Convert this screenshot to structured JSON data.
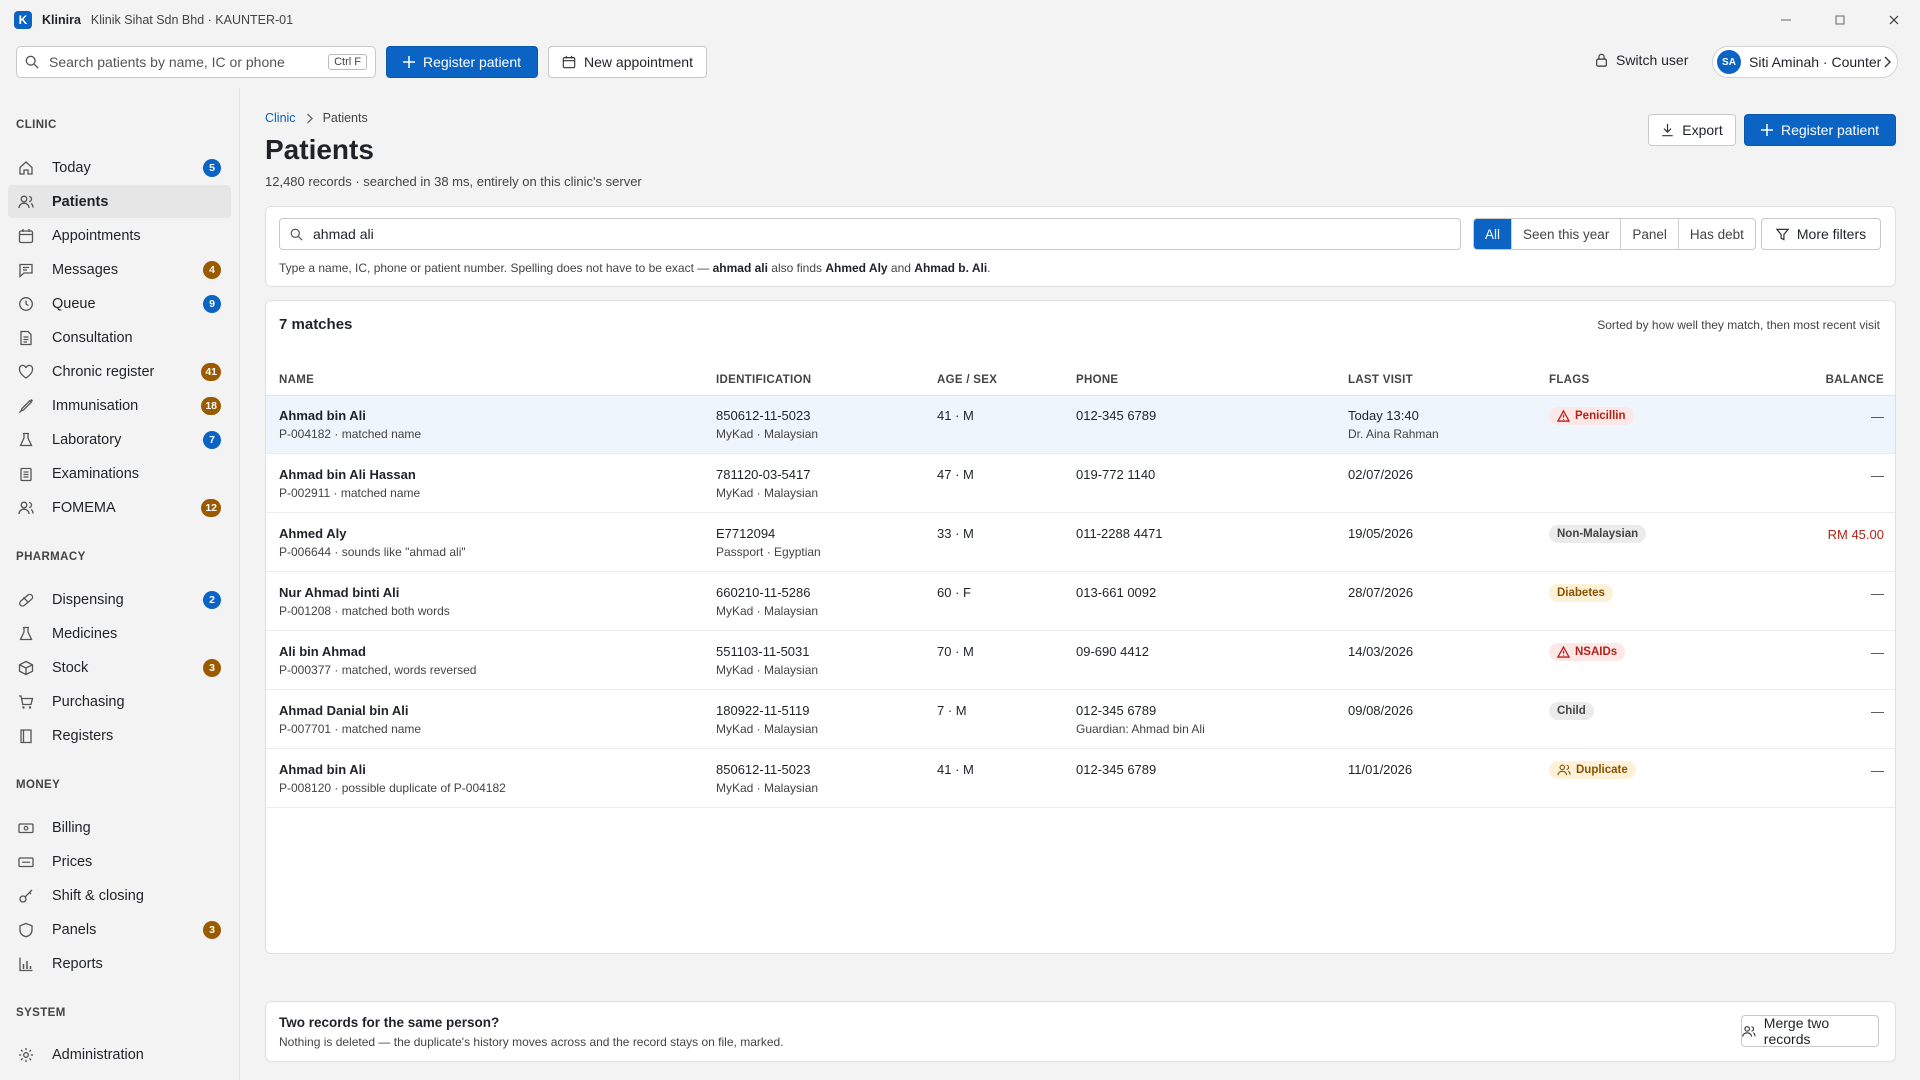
{
  "titlebar": {
    "app_logo": "K",
    "app_name": "Klinira",
    "context": "Klinik Sihat Sdn Bhd · KAUNTER-01"
  },
  "toolbar": {
    "search_placeholder": "Search patients by name, IC or phone",
    "search_shortcut": "Ctrl F",
    "register_label": "Register patient",
    "appointment_label": "New appointment",
    "switch_user_label": "Switch user",
    "user_initials": "SA",
    "user_label": "Siti Aminah · Counter"
  },
  "sidebar": {
    "clinic_title": "CLINIC",
    "clinic_items": [
      {
        "label": "Today",
        "icon": "home-icon",
        "badge": "5",
        "badge_color": "blue"
      },
      {
        "label": "Patients",
        "icon": "users-icon",
        "active": true
      },
      {
        "label": "Appointments",
        "icon": "calendar-icon"
      },
      {
        "label": "Messages",
        "icon": "message-icon",
        "badge": "4",
        "badge_color": "amber"
      },
      {
        "label": "Queue",
        "icon": "clock-icon",
        "badge": "9",
        "badge_color": "blue"
      },
      {
        "label": "Consultation",
        "icon": "document-icon"
      },
      {
        "label": "Chronic register",
        "icon": "heart-icon",
        "badge": "41",
        "badge_color": "amber"
      },
      {
        "label": "Immunisation",
        "icon": "syringe-icon",
        "badge": "18",
        "badge_color": "amber"
      },
      {
        "label": "Laboratory",
        "icon": "flask-icon",
        "badge": "7",
        "badge_color": "blue"
      },
      {
        "label": "Examinations",
        "icon": "clipboard-icon"
      },
      {
        "label": "FOMEMA",
        "icon": "people-icon",
        "badge": "12",
        "badge_color": "amber"
      }
    ],
    "pharmacy_title": "PHARMACY",
    "pharmacy_items": [
      {
        "label": "Dispensing",
        "icon": "pill-icon",
        "badge": "2",
        "badge_color": "blue"
      },
      {
        "label": "Medicines",
        "icon": "flask-icon"
      },
      {
        "label": "Stock",
        "icon": "box-icon",
        "badge": "3",
        "badge_color": "amber"
      },
      {
        "label": "Purchasing",
        "icon": "cart-icon"
      },
      {
        "label": "Registers",
        "icon": "book-icon"
      }
    ],
    "money_title": "MONEY",
    "money_items": [
      {
        "label": "Billing",
        "icon": "cash-icon"
      },
      {
        "label": "Prices",
        "icon": "tag-icon"
      },
      {
        "label": "Shift & closing",
        "icon": "key-icon"
      },
      {
        "label": "Panels",
        "icon": "shield-icon",
        "badge": "3",
        "badge_color": "amber"
      },
      {
        "label": "Reports",
        "icon": "bar-chart-icon"
      }
    ],
    "system_title": "SYSTEM",
    "system_items": [
      {
        "label": "Administration",
        "icon": "gear-icon"
      }
    ]
  },
  "main": {
    "breadcrumb_root": "Clinic",
    "breadcrumb_current": "Patients",
    "title": "Patients",
    "subtitle": "12,480 records · searched in 38 ms, entirely on this clinic's server",
    "export_label": "Export",
    "register_label": "Register patient"
  },
  "filters": {
    "query": "ahmad ali",
    "segments": [
      "All",
      "Seen this year",
      "Panel",
      "Has debt"
    ],
    "active_segment": "All",
    "more_label": "More filters",
    "hint_a": "Type a name, IC, phone or patient number. Spelling does not have to be exact — ",
    "hint_q": "ahmad ali",
    "hint_b": " also finds ",
    "hint_c": "Ahmed Aly",
    "hint_d": " and ",
    "hint_e": "Ahmad b. Ali",
    "hint_f": "."
  },
  "results": {
    "count": "7 matches",
    "sort_note": "Sorted by how well they match, then most recent visit",
    "columns": [
      "NAME",
      "IDENTIFICATION",
      "AGE / SEX",
      "PHONE",
      "LAST VISIT",
      "FLAGS",
      "BALANCE"
    ],
    "rows": [
      {
        "name": "Ahmad bin Ali",
        "sub": "P-004182 · matched name",
        "id": "850612-11-5023",
        "id_sub": "MyKad · Malaysian",
        "age": "41 · M",
        "phone": "012-345 6789",
        "phone_sub": "",
        "last": "Today 13:40",
        "last_sub": "Dr. Aina Rahman",
        "flag": "Penicillin",
        "flag_style": "red",
        "flag_icon": "warning-icon",
        "balance": "—",
        "selected": true
      },
      {
        "name": "Ahmad bin Ali Hassan",
        "sub": "P-002911 · matched name",
        "id": "781120-03-5417",
        "id_sub": "MyKad · Malaysian",
        "age": "47 · M",
        "phone": "019-772 1140",
        "phone_sub": "",
        "last": "02/07/2026",
        "last_sub": "",
        "flag": "",
        "flag_style": "",
        "flag_icon": "",
        "balance": "—"
      },
      {
        "name": "Ahmed Aly",
        "sub": "P-006644 · sounds like \"ahmad ali\"",
        "id": "E7712094",
        "id_sub": "Passport · Egyptian",
        "age": "33 · M",
        "phone": "011-2288 4471",
        "phone_sub": "",
        "last": "19/05/2026",
        "last_sub": "",
        "flag": "Non-Malaysian",
        "flag_style": "grey",
        "flag_icon": "",
        "balance": "RM 45.00",
        "debt": true
      },
      {
        "name": "Nur Ahmad binti Ali",
        "sub": "P-001208 · matched both words",
        "id": "660210-11-5286",
        "id_sub": "MyKad · Malaysian",
        "age": "60 · F",
        "phone": "013-661 0092",
        "phone_sub": "",
        "last": "28/07/2026",
        "last_sub": "",
        "flag": "Diabetes",
        "flag_style": "amber",
        "flag_icon": "",
        "balance": "—"
      },
      {
        "name": "Ali bin Ahmad",
        "sub": "P-000377 · matched, words reversed",
        "id": "551103-11-5031",
        "id_sub": "MyKad · Malaysian",
        "age": "70 · M",
        "phone": "09-690 4412",
        "phone_sub": "",
        "last": "14/03/2026",
        "last_sub": "",
        "flag": "NSAIDs",
        "flag_style": "red",
        "flag_icon": "warning-icon",
        "balance": "—"
      },
      {
        "name": "Ahmad Danial bin Ali",
        "sub": "P-007701 · matched name",
        "id": "180922-11-5119",
        "id_sub": "MyKad · Malaysian",
        "age": "7 · M",
        "phone": "012-345 6789",
        "phone_sub": "Guardian: Ahmad bin Ali",
        "last": "09/08/2026",
        "last_sub": "",
        "flag": "Child",
        "flag_style": "grey",
        "flag_icon": "",
        "balance": "—"
      },
      {
        "name": "Ahmad bin Ali",
        "sub": "P-008120 · possible duplicate of P-004182",
        "id": "850612-11-5023",
        "id_sub": "MyKad · Malaysian",
        "age": "41 · M",
        "phone": "012-345 6789",
        "phone_sub": "",
        "last": "11/01/2026",
        "last_sub": "",
        "flag": "Duplicate",
        "flag_style": "amber",
        "flag_icon": "people-icon",
        "balance": "—"
      }
    ]
  },
  "merge": {
    "title": "Two records for the same person?",
    "desc": "Nothing is deleted — the duplicate's history moves across and the record stays on file, marked.",
    "button_label": "Merge two records"
  },
  "colors": {
    "accent": "#0b63c4",
    "danger": "#b42318",
    "badge_amber": "#9a5a00",
    "selected_row": "#eef5fd"
  }
}
